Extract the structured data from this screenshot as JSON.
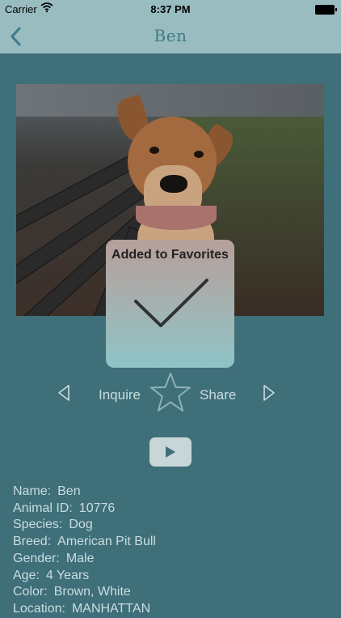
{
  "status_bar": {
    "carrier": "Carrier",
    "time": "8:37 PM"
  },
  "nav": {
    "title": "Ben",
    "back_icon": "chevron-left-icon"
  },
  "toast": {
    "message": "Added to Favorites",
    "icon": "checkmark-icon"
  },
  "actions": {
    "prev_icon": "triangle-left-icon",
    "inquire_label": "Inquire",
    "favorite_icon": "star-outline-icon",
    "share_label": "Share",
    "next_icon": "triangle-right-icon",
    "video_icon": "play-icon"
  },
  "details": [
    {
      "label": "Name:",
      "value": "Ben"
    },
    {
      "label": "Animal ID:",
      "value": "10776"
    },
    {
      "label": "Species:",
      "value": "Dog"
    },
    {
      "label": "Breed:",
      "value": "American Pit Bull"
    },
    {
      "label": "Gender:",
      "value": "Male"
    },
    {
      "label": "Age:",
      "value": "4 Years"
    },
    {
      "label": "Color:",
      "value": "Brown, White"
    },
    {
      "label": "Location:",
      "value": "MANHATTAN"
    }
  ],
  "colors": {
    "background": "#3f6f79",
    "navbar": "#98bcc0",
    "title": "#3f7a87",
    "text": "#c9dde0"
  }
}
